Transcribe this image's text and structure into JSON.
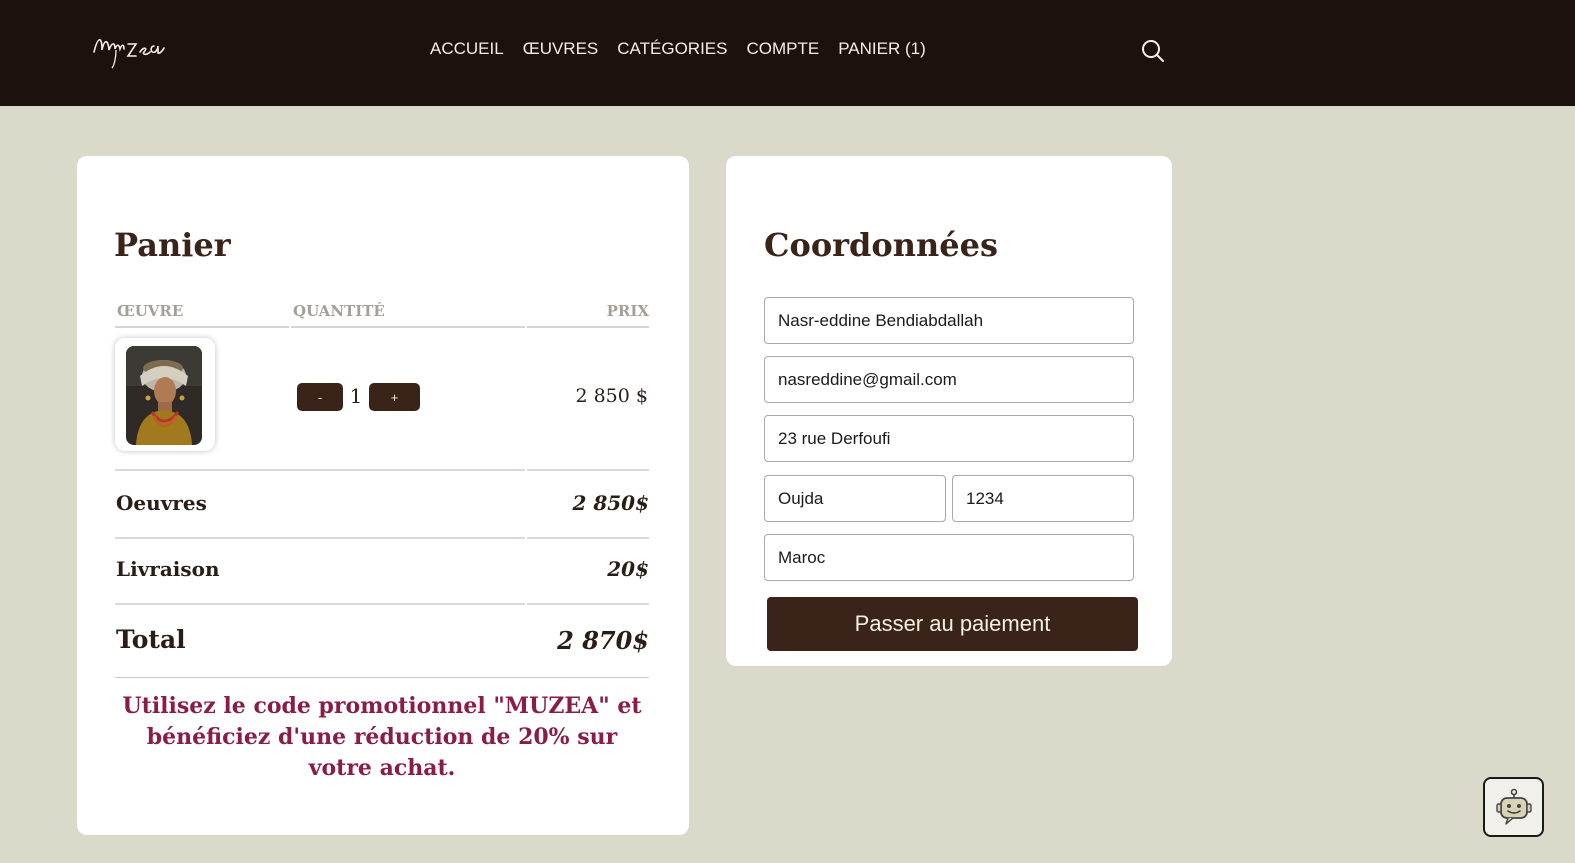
{
  "brand": {
    "logo_text": "Muzea"
  },
  "nav": {
    "items": [
      "ACCUEIL",
      "ŒUVRES",
      "CATÉGORIES",
      "COMPTE",
      "PANIER (1)"
    ]
  },
  "cart": {
    "title": "Panier",
    "columns": {
      "oeuvre": "ŒUVRE",
      "quantite": "QUANTITÉ",
      "prix": "PRIX"
    },
    "item": {
      "quantity": "1",
      "decrement_label": "-",
      "increment_label": "+",
      "price": "2 850 $"
    },
    "summary": {
      "oeuvres_label": "Oeuvres",
      "oeuvres_value": "2 850$",
      "livraison_label": "Livraison",
      "livraison_value": "20$",
      "total_label": "Total",
      "total_value": "2 870$"
    },
    "promo": "Utilisez le code promotionnel \"MUZEA\" et bénéficiez d'une réduction de 20% sur votre achat."
  },
  "coordonnees": {
    "title": "Coordonnées",
    "name": "Nasr-eddine Bendiabdallah",
    "email": "nasreddine@gmail.com",
    "address": "23 rue Derfoufi",
    "city": "Oujda",
    "zip": "1234",
    "country": "Maroc",
    "submit_label": "Passer au paiement"
  },
  "icons": {
    "search": "search-icon",
    "chatbot": "chatbot-icon"
  },
  "colors": {
    "nav_bg": "#1c120d",
    "page_bg": "#dbd9c9",
    "accent": "#3a2419",
    "promo": "#8a1d47"
  }
}
